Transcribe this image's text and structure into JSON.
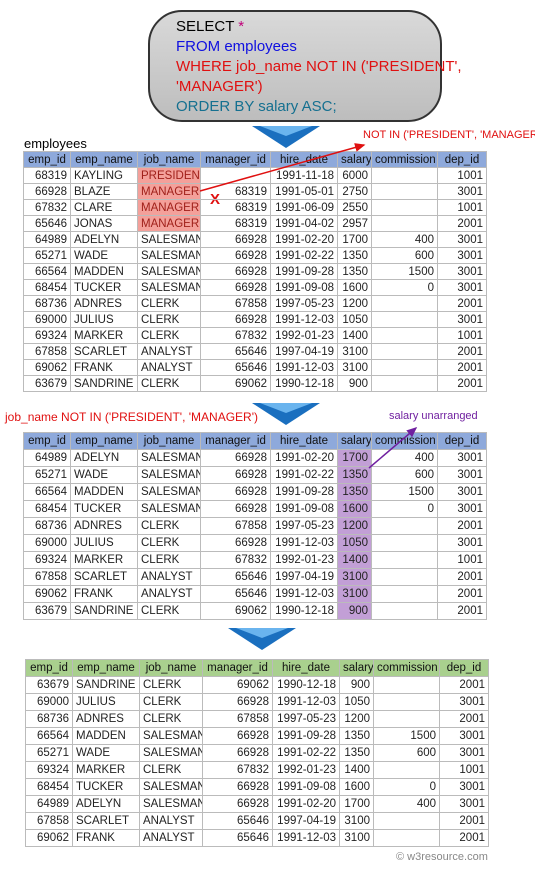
{
  "sql": {
    "line0": "SELECT ",
    "star": "*",
    "line1": "FROM employees",
    "line2": "WHERE job_name NOT IN ('PRESIDENT',",
    "line3": "'MANAGER')",
    "line4": "ORDER BY salary ASC;"
  },
  "table_name": "employees",
  "annotations": {
    "not_in": "NOT IN ('PRESIDENT', 'MANAGER')",
    "x_mark": "X",
    "filter": "job_name NOT IN ('PRESIDENT', 'MANAGER')",
    "unarranged": "salary unarranged",
    "watermark": "© w3resource.com"
  },
  "colors": {
    "header_blue": "#8ea9db",
    "header_green": "#a9d08e",
    "highlight_red": "#f4a09a",
    "highlight_purple": "#c29fd6",
    "arrow_blue": "#1a6fbf"
  },
  "columns": [
    "emp_id",
    "emp_name",
    "job_name",
    "manager_id",
    "hire_date",
    "salary",
    "commission",
    "dep_id"
  ],
  "table1": [
    [
      "68319",
      "KAYLING",
      "PRESIDENT",
      "",
      "1991-11-18",
      "6000",
      "",
      "1001"
    ],
    [
      "66928",
      "BLAZE",
      "MANAGER",
      "68319",
      "1991-05-01",
      "2750",
      "",
      "3001"
    ],
    [
      "67832",
      "CLARE",
      "MANAGER",
      "68319",
      "1991-06-09",
      "2550",
      "",
      "1001"
    ],
    [
      "65646",
      "JONAS",
      "MANAGER",
      "68319",
      "1991-04-02",
      "2957",
      "",
      "2001"
    ],
    [
      "64989",
      "ADELYN",
      "SALESMAN",
      "66928",
      "1991-02-20",
      "1700",
      "400",
      "3001"
    ],
    [
      "65271",
      "WADE",
      "SALESMAN",
      "66928",
      "1991-02-22",
      "1350",
      "600",
      "3001"
    ],
    [
      "66564",
      "MADDEN",
      "SALESMAN",
      "66928",
      "1991-09-28",
      "1350",
      "1500",
      "3001"
    ],
    [
      "68454",
      "TUCKER",
      "SALESMAN",
      "66928",
      "1991-09-08",
      "1600",
      "0",
      "3001"
    ],
    [
      "68736",
      "ADNRES",
      "CLERK",
      "67858",
      "1997-05-23",
      "1200",
      "",
      "2001"
    ],
    [
      "69000",
      "JULIUS",
      "CLERK",
      "66928",
      "1991-12-03",
      "1050",
      "",
      "3001"
    ],
    [
      "69324",
      "MARKER",
      "CLERK",
      "67832",
      "1992-01-23",
      "1400",
      "",
      "1001"
    ],
    [
      "67858",
      "SCARLET",
      "ANALYST",
      "65646",
      "1997-04-19",
      "3100",
      "",
      "2001"
    ],
    [
      "69062",
      "FRANK",
      "ANALYST",
      "65646",
      "1991-12-03",
      "3100",
      "",
      "2001"
    ],
    [
      "63679",
      "SANDRINE",
      "CLERK",
      "69062",
      "1990-12-18",
      "900",
      "",
      "2001"
    ]
  ],
  "table2": [
    [
      "64989",
      "ADELYN",
      "SALESMAN",
      "66928",
      "1991-02-20",
      "1700",
      "400",
      "3001"
    ],
    [
      "65271",
      "WADE",
      "SALESMAN",
      "66928",
      "1991-02-22",
      "1350",
      "600",
      "3001"
    ],
    [
      "66564",
      "MADDEN",
      "SALESMAN",
      "66928",
      "1991-09-28",
      "1350",
      "1500",
      "3001"
    ],
    [
      "68454",
      "TUCKER",
      "SALESMAN",
      "66928",
      "1991-09-08",
      "1600",
      "0",
      "3001"
    ],
    [
      "68736",
      "ADNRES",
      "CLERK",
      "67858",
      "1997-05-23",
      "1200",
      "",
      "2001"
    ],
    [
      "69000",
      "JULIUS",
      "CLERK",
      "66928",
      "1991-12-03",
      "1050",
      "",
      "3001"
    ],
    [
      "69324",
      "MARKER",
      "CLERK",
      "67832",
      "1992-01-23",
      "1400",
      "",
      "1001"
    ],
    [
      "67858",
      "SCARLET",
      "ANALYST",
      "65646",
      "1997-04-19",
      "3100",
      "",
      "2001"
    ],
    [
      "69062",
      "FRANK",
      "ANALYST",
      "65646",
      "1991-12-03",
      "3100",
      "",
      "2001"
    ],
    [
      "63679",
      "SANDRINE",
      "CLERK",
      "69062",
      "1990-12-18",
      "900",
      "",
      "2001"
    ]
  ],
  "table3": [
    [
      "63679",
      "SANDRINE",
      "CLERK",
      "69062",
      "1990-12-18",
      "900",
      "",
      "2001"
    ],
    [
      "69000",
      "JULIUS",
      "CLERK",
      "66928",
      "1991-12-03",
      "1050",
      "",
      "3001"
    ],
    [
      "68736",
      "ADNRES",
      "CLERK",
      "67858",
      "1997-05-23",
      "1200",
      "",
      "2001"
    ],
    [
      "66564",
      "MADDEN",
      "SALESMAN",
      "66928",
      "1991-09-28",
      "1350",
      "1500",
      "3001"
    ],
    [
      "65271",
      "WADE",
      "SALESMAN",
      "66928",
      "1991-02-22",
      "1350",
      "600",
      "3001"
    ],
    [
      "69324",
      "MARKER",
      "CLERK",
      "67832",
      "1992-01-23",
      "1400",
      "",
      "1001"
    ],
    [
      "68454",
      "TUCKER",
      "SALESMAN",
      "66928",
      "1991-09-08",
      "1600",
      "0",
      "3001"
    ],
    [
      "64989",
      "ADELYN",
      "SALESMAN",
      "66928",
      "1991-02-20",
      "1700",
      "400",
      "3001"
    ],
    [
      "67858",
      "SCARLET",
      "ANALYST",
      "65646",
      "1997-04-19",
      "3100",
      "",
      "2001"
    ],
    [
      "69062",
      "FRANK",
      "ANALYST",
      "65646",
      "1991-12-03",
      "3100",
      "",
      "2001"
    ]
  ]
}
